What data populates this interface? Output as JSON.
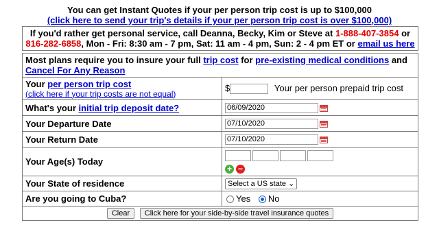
{
  "header": {
    "line1": "You can get Instant Quotes if your per person trip cost is up to $100,000",
    "line2": "(click here to send your trip's details if your per person trip cost is over $100,000)"
  },
  "contact": {
    "text1": "If you'd rather get personal service, call Deanna, Becky, Kim or Steve at ",
    "phone1": "1-888-407-3854",
    "or": " or ",
    "phone2": "816-282-6858",
    "text2": ", Mon - Fri: 8:30 am - 7 pm, Sat: 11 am - 4 pm, Sun: 2 - 4 pm ET or ",
    "email_link": "email us here"
  },
  "plans": {
    "text1": "Most plans require you to insure your full ",
    "link1": "trip cost",
    "text2": " for ",
    "link2": "pre-existing medical conditions",
    "text3": " and ",
    "link3": "Cancel For Any Reason"
  },
  "form": {
    "trip_cost": {
      "label_prefix": "Your ",
      "label_link": "per person trip cost",
      "sub_link": "(click here if your trip costs are not equal)",
      "currency": "$",
      "value": "",
      "helper": "Your per person prepaid trip cost"
    },
    "deposit": {
      "label_prefix": "What's your ",
      "label_link": "initial trip deposit date?",
      "value": "06/09/2020"
    },
    "departure": {
      "label": "Your Departure Date",
      "value": "07/10/2020"
    },
    "return": {
      "label": "Your Return Date",
      "value": "07/10/2020"
    },
    "ages": {
      "label": "Your Age(s) Today",
      "add": "+",
      "remove": "−"
    },
    "state": {
      "label": "Your State of residence",
      "selected": "Select a US state"
    },
    "cuba": {
      "label": "Are you going to Cuba?",
      "yes": "Yes",
      "no": "No",
      "selected": "No"
    },
    "buttons": {
      "clear": "Clear",
      "submit": "Click here for your side-by-side travel insurance quotes"
    }
  }
}
